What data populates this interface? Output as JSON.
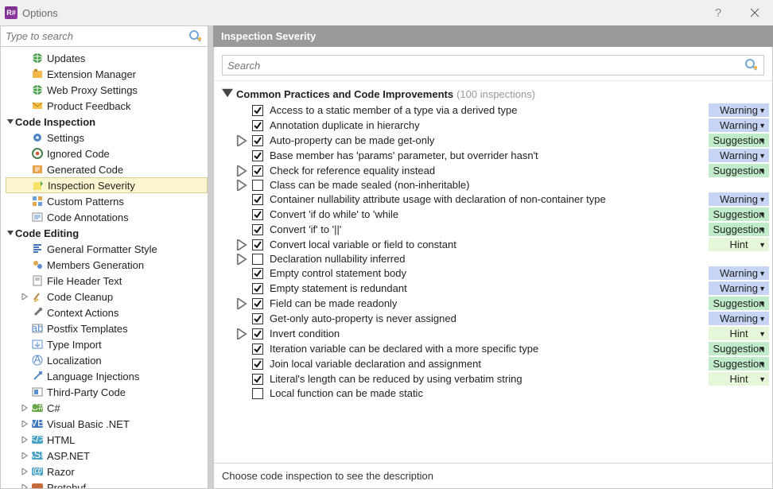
{
  "window": {
    "title": "Options"
  },
  "search": {
    "left_placeholder": "Type to search",
    "right_placeholder": "Search"
  },
  "right": {
    "header": "Inspection Severity",
    "description": "Choose code inspection to see the description"
  },
  "tree": [
    {
      "label": "Updates",
      "lvl": 1,
      "icon": "globe"
    },
    {
      "label": "Extension Manager",
      "lvl": 1,
      "icon": "ext"
    },
    {
      "label": "Web Proxy Settings",
      "lvl": 1,
      "icon": "globe"
    },
    {
      "label": "Product Feedback",
      "lvl": 1,
      "icon": "mail"
    },
    {
      "label": "Code Inspection",
      "lvl": 0,
      "heading": true,
      "exp": "down"
    },
    {
      "label": "Settings",
      "lvl": 1,
      "icon": "gear"
    },
    {
      "label": "Ignored Code",
      "lvl": 1,
      "icon": "ignored"
    },
    {
      "label": "Generated Code",
      "lvl": 1,
      "icon": "gen"
    },
    {
      "label": "Inspection Severity",
      "lvl": 1,
      "icon": "severity",
      "selected": true
    },
    {
      "label": "Custom Patterns",
      "lvl": 1,
      "icon": "pattern"
    },
    {
      "label": "Code Annotations",
      "lvl": 1,
      "icon": "annot"
    },
    {
      "label": "Code Editing",
      "lvl": 0,
      "heading": true,
      "exp": "down"
    },
    {
      "label": "General Formatter Style",
      "lvl": 1,
      "icon": "format"
    },
    {
      "label": "Members Generation",
      "lvl": 1,
      "icon": "members"
    },
    {
      "label": "File Header Text",
      "lvl": 1,
      "icon": "file"
    },
    {
      "label": "Code Cleanup",
      "lvl": 1,
      "icon": "broom",
      "exp": "right"
    },
    {
      "label": "Context Actions",
      "lvl": 1,
      "icon": "wrench"
    },
    {
      "label": "Postfix Templates",
      "lvl": 1,
      "icon": "postfix"
    },
    {
      "label": "Type Import",
      "lvl": 1,
      "icon": "import"
    },
    {
      "label": "Localization",
      "lvl": 1,
      "icon": "loc"
    },
    {
      "label": "Language Injections",
      "lvl": 1,
      "icon": "inject"
    },
    {
      "label": "Third-Party Code",
      "lvl": 1,
      "icon": "third"
    },
    {
      "label": "C#",
      "lvl": 1,
      "icon": "cs",
      "exp": "right"
    },
    {
      "label": "Visual Basic .NET",
      "lvl": 1,
      "icon": "vb",
      "exp": "right"
    },
    {
      "label": "HTML",
      "lvl": 1,
      "icon": "html",
      "exp": "right"
    },
    {
      "label": "ASP.NET",
      "lvl": 1,
      "icon": "asp",
      "exp": "right"
    },
    {
      "label": "Razor",
      "lvl": 1,
      "icon": "razor",
      "exp": "right"
    },
    {
      "label": "Protobuf",
      "lvl": 1,
      "icon": "proto",
      "exp": "right"
    }
  ],
  "group": {
    "name": "Common Practices and Code Improvements",
    "count": "(100 inspections)"
  },
  "inspections": [
    {
      "name": "Access to a static member of a type via a derived type",
      "checked": true,
      "sev": "Warning"
    },
    {
      "name": "Annotation duplicate in hierarchy",
      "checked": true,
      "sev": "Warning"
    },
    {
      "name": "Auto-property can be made get-only",
      "checked": true,
      "exp": "right",
      "sev": "Suggestion"
    },
    {
      "name": "Base member has 'params' parameter, but overrider hasn't",
      "checked": true,
      "sev": "Warning"
    },
    {
      "name": "Check for reference equality instead",
      "checked": true,
      "exp": "right",
      "sev": "Suggestion"
    },
    {
      "name": "Class can be made sealed (non-inheritable)",
      "checked": false,
      "exp": "right"
    },
    {
      "name": "Container nullability attribute usage with declaration of non-container type",
      "checked": true,
      "sev": "Warning"
    },
    {
      "name": "Convert 'if do while' to 'while",
      "checked": true,
      "sev": "Suggestion"
    },
    {
      "name": "Convert 'if' to '||'",
      "checked": true,
      "sev": "Suggestion"
    },
    {
      "name": "Convert local variable or field to constant",
      "checked": true,
      "exp": "right",
      "sev": "Hint"
    },
    {
      "name": "Declaration nullability inferred",
      "checked": false,
      "exp": "right"
    },
    {
      "name": "Empty control statement body",
      "checked": true,
      "sev": "Warning"
    },
    {
      "name": "Empty statement is redundant",
      "checked": true,
      "sev": "Warning"
    },
    {
      "name": "Field can be made readonly",
      "checked": true,
      "exp": "right",
      "sev": "Suggestion"
    },
    {
      "name": "Get-only auto-property is never assigned",
      "checked": true,
      "sev": "Warning"
    },
    {
      "name": "Invert condition",
      "checked": true,
      "exp": "right",
      "sev": "Hint"
    },
    {
      "name": "Iteration variable can be declared with a more specific type",
      "checked": true,
      "sev": "Suggestion"
    },
    {
      "name": "Join local variable declaration and assignment",
      "checked": true,
      "sev": "Suggestion"
    },
    {
      "name": "Literal's length can be reduced by using verbatim string",
      "checked": true,
      "sev": "Hint"
    },
    {
      "name": "Local function can be made static",
      "checked": false
    }
  ]
}
